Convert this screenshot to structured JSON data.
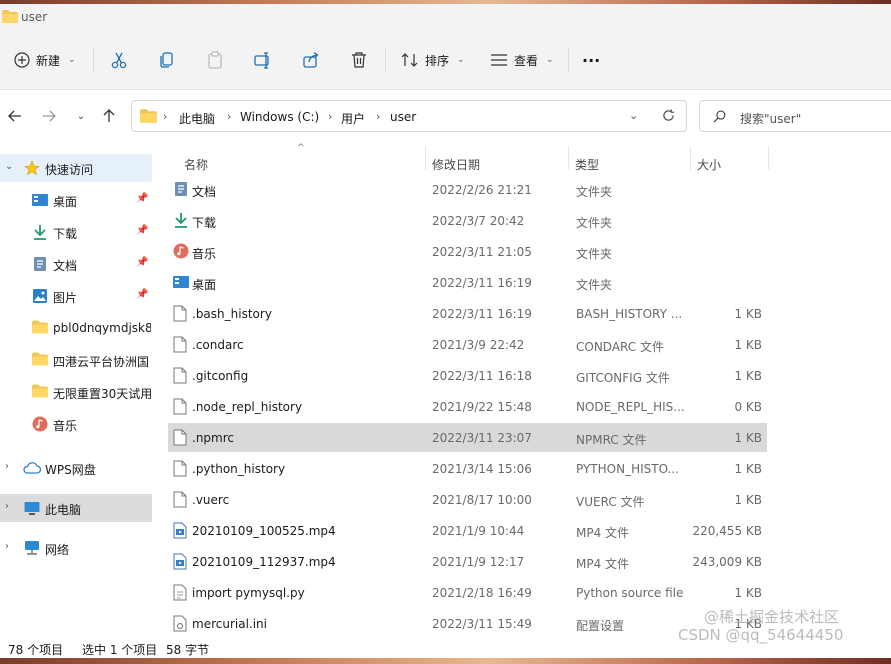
{
  "window": {
    "title": "user"
  },
  "toolbar": {
    "new_label": "新建",
    "sort_label": "排序",
    "view_label": "查看",
    "more_label": "···"
  },
  "address": {
    "crumbs": [
      "此电脑",
      "Windows (C:)",
      "用户",
      "user"
    ]
  },
  "search": {
    "placeholder": "搜索\"user\""
  },
  "sidebar": {
    "quick_access": "快速访问",
    "items": [
      {
        "label": "桌面",
        "pinned": true,
        "icon": "desktop-icon"
      },
      {
        "label": "下载",
        "pinned": true,
        "icon": "download-icon"
      },
      {
        "label": "文档",
        "pinned": true,
        "icon": "document-icon"
      },
      {
        "label": "图片",
        "pinned": true,
        "icon": "picture-icon"
      },
      {
        "label": "pbl0dnqymdjsk8",
        "pinned": false,
        "icon": "folder-icon"
      },
      {
        "label": "四港云平台协洲国",
        "pinned": false,
        "icon": "folder-icon"
      },
      {
        "label": "无限重置30天试用",
        "pinned": false,
        "icon": "folder-icon"
      },
      {
        "label": "音乐",
        "pinned": false,
        "icon": "music-icon"
      }
    ],
    "wps": "WPS网盘",
    "this_pc": "此电脑",
    "network": "网络"
  },
  "columns": {
    "name": "名称",
    "date": "修改日期",
    "type": "类型",
    "size": "大小"
  },
  "files": [
    {
      "name": "文档",
      "date": "2022/2/26 21:21",
      "type": "文件夹",
      "size": "",
      "icon": "documents-folder-icon"
    },
    {
      "name": "下载",
      "date": "2022/3/7 20:42",
      "type": "文件夹",
      "size": "",
      "icon": "download-icon"
    },
    {
      "name": "音乐",
      "date": "2022/3/11 21:05",
      "type": "文件夹",
      "size": "",
      "icon": "music-icon"
    },
    {
      "name": "桌面",
      "date": "2022/3/11 16:19",
      "type": "文件夹",
      "size": "",
      "icon": "desktop-icon"
    },
    {
      "name": ".bash_history",
      "date": "2022/3/11 16:19",
      "type": "BASH_HISTORY ...",
      "size": "1 KB",
      "icon": "file-icon"
    },
    {
      "name": ".condarc",
      "date": "2021/3/9 22:42",
      "type": "CONDARC 文件",
      "size": "1 KB",
      "icon": "file-icon"
    },
    {
      "name": ".gitconfig",
      "date": "2022/3/11 16:18",
      "type": "GITCONFIG 文件",
      "size": "1 KB",
      "icon": "file-icon"
    },
    {
      "name": ".node_repl_history",
      "date": "2021/9/22 15:48",
      "type": "NODE_REPL_HIS...",
      "size": "0 KB",
      "icon": "file-icon"
    },
    {
      "name": ".npmrc",
      "date": "2022/3/11 23:07",
      "type": "NPMRC 文件",
      "size": "1 KB",
      "icon": "file-icon"
    },
    {
      "name": ".python_history",
      "date": "2021/3/14 15:06",
      "type": "PYTHON_HISTO...",
      "size": "1 KB",
      "icon": "file-icon"
    },
    {
      "name": ".vuerc",
      "date": "2021/8/17 10:00",
      "type": "VUERC 文件",
      "size": "1 KB",
      "icon": "file-icon"
    },
    {
      "name": "20210109_100525.mp4",
      "date": "2021/1/9 10:44",
      "type": "MP4 文件",
      "size": "220,455 KB",
      "icon": "video-icon"
    },
    {
      "name": "20210109_112937.mp4",
      "date": "2021/1/9 12:17",
      "type": "MP4 文件",
      "size": "243,009 KB",
      "icon": "video-icon"
    },
    {
      "name": "import pymysql.py",
      "date": "2021/2/18 16:49",
      "type": "Python source file",
      "size": "1 KB",
      "icon": "python-file-icon"
    },
    {
      "name": "mercurial.ini",
      "date": "2022/3/11 15:49",
      "type": "配置设置",
      "size": "1 KB",
      "icon": "settings-file-icon"
    }
  ],
  "status": {
    "count": "78 个项目",
    "selected": "选中 1 个项目",
    "selsize": "58 字节"
  },
  "watermark": "CSDN @qq_54644450",
  "watermark2": "@稀土掘金技术社区"
}
